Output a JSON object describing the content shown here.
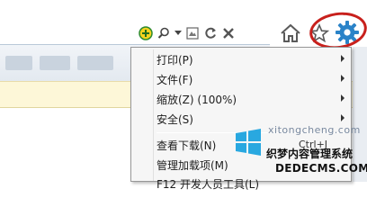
{
  "toolbar": {
    "icons": [
      "plus-green-icon",
      "search-icon",
      "dropdown-arrow-icon",
      "compat-view-icon",
      "refresh-icon",
      "stop-icon",
      "home-icon",
      "favorites-star-icon",
      "tools-gear-icon"
    ],
    "gear_highlight_color": "#c8201c",
    "gear_color": "#2a83c8"
  },
  "tools_menu": {
    "items": [
      {
        "label": "打印(P)",
        "submenu": true
      },
      {
        "label": "文件(F)",
        "submenu": true
      },
      {
        "label": "缩放(Z) (100%)",
        "submenu": true
      },
      {
        "label": "安全(S)",
        "submenu": true
      },
      {
        "label": "查看下载(N)",
        "accel": "Ctrl+J"
      },
      {
        "label": "管理加载项(M)"
      },
      {
        "label": "F12 开发人员工具(L)"
      }
    ]
  },
  "watermark": {
    "site_text": "xitongcheng.com",
    "brand_text": "织梦内容管理系统",
    "url_text": "DEDECMS.COM"
  }
}
